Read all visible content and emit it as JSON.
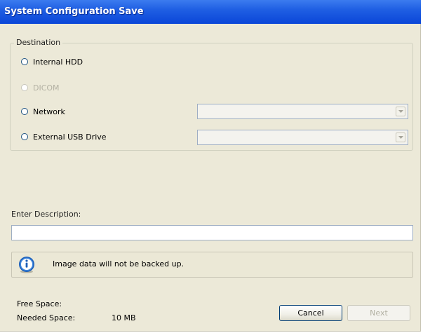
{
  "window": {
    "title": "System Configuration Save"
  },
  "destination": {
    "group_label": "Destination",
    "options": [
      {
        "label": "Internal HDD",
        "selected": false,
        "enabled": true
      },
      {
        "label": "DICOM",
        "selected": false,
        "enabled": false
      },
      {
        "label": "Network",
        "selected": false,
        "enabled": true,
        "combo_value": ""
      },
      {
        "label": "External USB Drive",
        "selected": false,
        "enabled": true,
        "combo_value": ""
      }
    ]
  },
  "description": {
    "label": "Enter Description:",
    "value": "",
    "placeholder": ""
  },
  "info": {
    "icon": "info-icon",
    "message": "Image data will not be backed up."
  },
  "space": {
    "free_label": "Free Space:",
    "free_value": "",
    "needed_label": "Needed Space:",
    "needed_value": "10 MB"
  },
  "buttons": {
    "cancel": "Cancel",
    "next": "Next"
  },
  "colors": {
    "title_bar": "#0a46d8",
    "dialog_bg": "#ece9d8",
    "info_icon": "#1c5fb9"
  }
}
